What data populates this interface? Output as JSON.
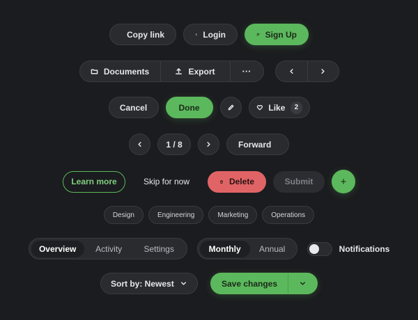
{
  "row1": {
    "copy_link": "Copy link",
    "login": "Login",
    "sign_up": "Sign Up"
  },
  "row2": {
    "documents": "Documents",
    "export": "Export",
    "more": "···"
  },
  "row3": {
    "cancel": "Cancel",
    "done": "Done",
    "like": "Like",
    "like_count": "2"
  },
  "row4": {
    "page": "1 / 8",
    "forward": "Forward"
  },
  "row5": {
    "learn_more": "Learn more",
    "skip": "Skip for now",
    "delete": "Delete",
    "submit": "Submit",
    "add": "+"
  },
  "chips": [
    "Design",
    "Engineering",
    "Marketing",
    "Operations"
  ],
  "tabs": {
    "items": [
      "Overview",
      "Activity",
      "Settings"
    ],
    "active": "Overview"
  },
  "billing": {
    "items": [
      "Monthly",
      "Annual"
    ],
    "active": "Monthly"
  },
  "notifications": {
    "label": "Notifications",
    "on": false
  },
  "row8": {
    "sort": "Sort by: Newest",
    "save": "Save changes"
  },
  "colors": {
    "background": "#1b1c1f",
    "accent": "#5cb85c",
    "danger": "#e06466"
  }
}
